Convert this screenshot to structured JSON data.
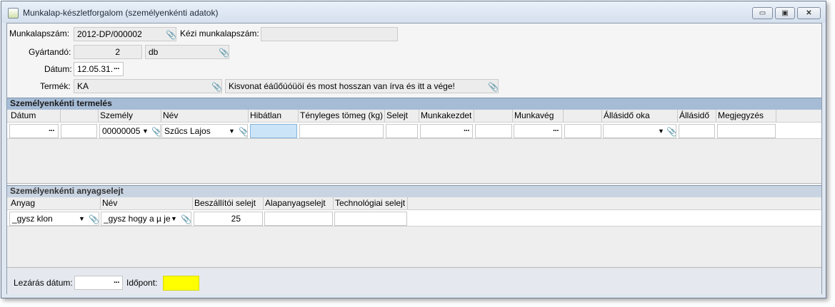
{
  "window": {
    "title": "Munkalap-készletforgalom (személyenkénti adatok)",
    "controls": {
      "minimize": "▭",
      "maximize": "▣",
      "close": "✕"
    }
  },
  "header_form": {
    "munkalapszam_label": "Munkalapszám:",
    "munkalapszam_value": "2012-DP/000002",
    "kezi_label": "Kézi munkalapszám:",
    "kezi_value": "",
    "gyartando_label": "Gyártandó:",
    "gyartando_qty": "2",
    "gyartando_unit": "db",
    "datum_label": "Dátum:",
    "datum_value": "12.05.31.",
    "termek_label": "Termék:",
    "termek_code": "KA",
    "termek_name": "Kisvonat éáűőúóüöí és most hosszan van írva és itt a vége!"
  },
  "termeles": {
    "title": "Személyenkénti termelés",
    "columns": [
      "Dátum",
      "",
      "Személy",
      "Név",
      "Hibátlan",
      "Tényleges tömeg (kg)",
      "Selejt",
      "Munkakezdet",
      "",
      "Munkavég",
      "",
      "Állásidő oka",
      "Állásidő",
      "Megjegyzés"
    ],
    "row": {
      "szemely": "00000005",
      "nev": "Szűcs Lajos"
    }
  },
  "anyagselejt": {
    "title": "Személyenkénti anyagselejt",
    "columns": [
      "Anyag",
      "Név",
      "Beszállítói selejt",
      "Alapanyagselejt",
      "Technológiai selejt"
    ],
    "row": {
      "anyag": "_gysz klon",
      "nev": "_gysz hogy a µ jele",
      "beszallitoi": "25",
      "alapanyag": "",
      "technologiai": ""
    }
  },
  "footer": {
    "lezaras_label": "Lezárás dátum:",
    "lezaras_value": "",
    "idopont_label": "Időpont:",
    "idopont_value": ""
  },
  "icons": {
    "clip": "paperclip-icon",
    "dots": "ellipsis-icon",
    "arrow": "dropdown-arrow-icon"
  },
  "colors": {
    "section_header": "#a6bcd6",
    "highlight_cell": "#cce4f7",
    "idopont": "#ffff00"
  }
}
